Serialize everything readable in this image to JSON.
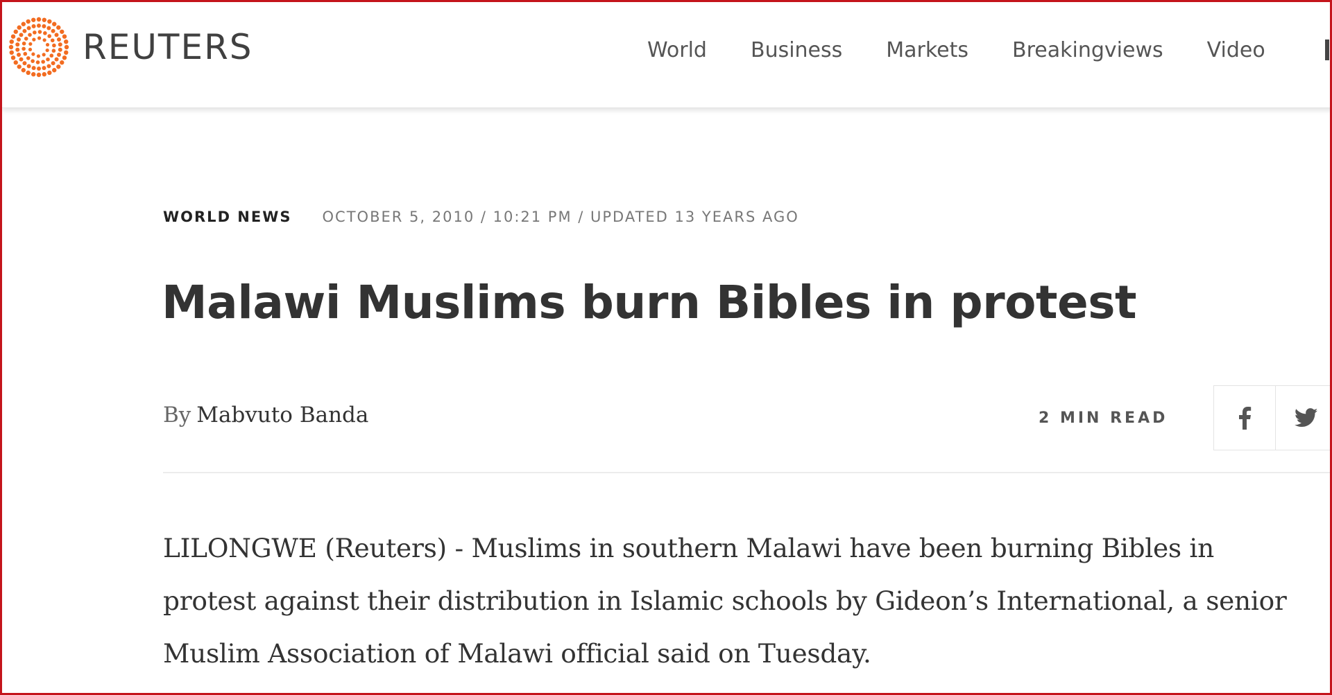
{
  "header": {
    "logo_text": "REUTERS",
    "nav": [
      "World",
      "Business",
      "Markets",
      "Breakingviews",
      "Video"
    ]
  },
  "article": {
    "section": "WORLD NEWS",
    "dateline": "OCTOBER 5, 2010 / 10:21 PM / UPDATED 13 YEARS AGO",
    "headline": "Malawi Muslims burn Bibles in protest",
    "byline_prefix": "By",
    "author": "Mabvuto Banda",
    "read_time": "2 MIN READ",
    "body_lines": [
      "LILONGWE (Reuters) - Muslims in southern Malawi have been burning Bibles in",
      "protest against their distribution in Islamic schools by Gideon’s International, a senior",
      "Muslim Association of Malawi official said on Tuesday."
    ]
  },
  "share": {
    "icons": [
      "facebook-icon",
      "twitter-icon"
    ]
  },
  "colors": {
    "frame_border": "#c4141b",
    "logo_orange": "#f26c21",
    "text_dark": "#333333",
    "text_muted": "#777777"
  }
}
